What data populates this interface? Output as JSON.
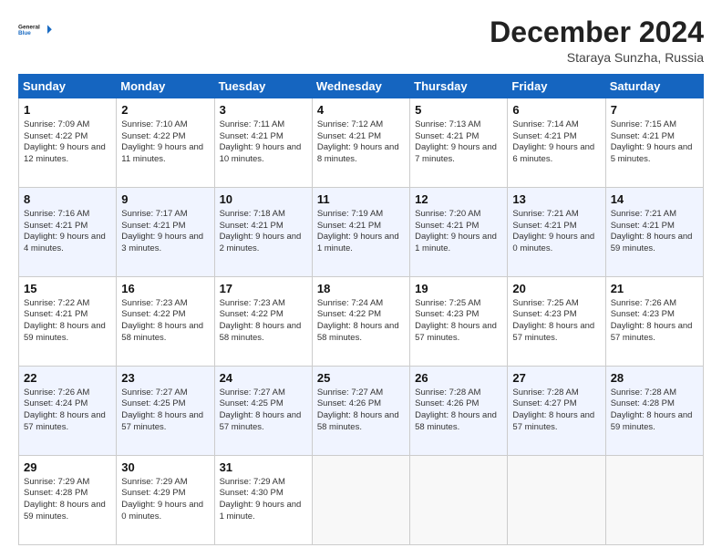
{
  "logo": {
    "line1": "General",
    "line2": "Blue"
  },
  "title": "December 2024",
  "location": "Staraya Sunzha, Russia",
  "days_of_week": [
    "Sunday",
    "Monday",
    "Tuesday",
    "Wednesday",
    "Thursday",
    "Friday",
    "Saturday"
  ],
  "weeks": [
    [
      {
        "day": "1",
        "sr": "7:09 AM",
        "ss": "4:22 PM",
        "dl": "9 hours and 12 minutes."
      },
      {
        "day": "2",
        "sr": "7:10 AM",
        "ss": "4:22 PM",
        "dl": "9 hours and 11 minutes."
      },
      {
        "day": "3",
        "sr": "7:11 AM",
        "ss": "4:21 PM",
        "dl": "9 hours and 10 minutes."
      },
      {
        "day": "4",
        "sr": "7:12 AM",
        "ss": "4:21 PM",
        "dl": "9 hours and 8 minutes."
      },
      {
        "day": "5",
        "sr": "7:13 AM",
        "ss": "4:21 PM",
        "dl": "9 hours and 7 minutes."
      },
      {
        "day": "6",
        "sr": "7:14 AM",
        "ss": "4:21 PM",
        "dl": "9 hours and 6 minutes."
      },
      {
        "day": "7",
        "sr": "7:15 AM",
        "ss": "4:21 PM",
        "dl": "9 hours and 5 minutes."
      }
    ],
    [
      {
        "day": "8",
        "sr": "7:16 AM",
        "ss": "4:21 PM",
        "dl": "9 hours and 4 minutes."
      },
      {
        "day": "9",
        "sr": "7:17 AM",
        "ss": "4:21 PM",
        "dl": "9 hours and 3 minutes."
      },
      {
        "day": "10",
        "sr": "7:18 AM",
        "ss": "4:21 PM",
        "dl": "9 hours and 2 minutes."
      },
      {
        "day": "11",
        "sr": "7:19 AM",
        "ss": "4:21 PM",
        "dl": "9 hours and 1 minute."
      },
      {
        "day": "12",
        "sr": "7:20 AM",
        "ss": "4:21 PM",
        "dl": "9 hours and 1 minute."
      },
      {
        "day": "13",
        "sr": "7:21 AM",
        "ss": "4:21 PM",
        "dl": "9 hours and 0 minutes."
      },
      {
        "day": "14",
        "sr": "7:21 AM",
        "ss": "4:21 PM",
        "dl": "8 hours and 59 minutes."
      }
    ],
    [
      {
        "day": "15",
        "sr": "7:22 AM",
        "ss": "4:21 PM",
        "dl": "8 hours and 59 minutes."
      },
      {
        "day": "16",
        "sr": "7:23 AM",
        "ss": "4:22 PM",
        "dl": "8 hours and 58 minutes."
      },
      {
        "day": "17",
        "sr": "7:23 AM",
        "ss": "4:22 PM",
        "dl": "8 hours and 58 minutes."
      },
      {
        "day": "18",
        "sr": "7:24 AM",
        "ss": "4:22 PM",
        "dl": "8 hours and 58 minutes."
      },
      {
        "day": "19",
        "sr": "7:25 AM",
        "ss": "4:23 PM",
        "dl": "8 hours and 57 minutes."
      },
      {
        "day": "20",
        "sr": "7:25 AM",
        "ss": "4:23 PM",
        "dl": "8 hours and 57 minutes."
      },
      {
        "day": "21",
        "sr": "7:26 AM",
        "ss": "4:23 PM",
        "dl": "8 hours and 57 minutes."
      }
    ],
    [
      {
        "day": "22",
        "sr": "7:26 AM",
        "ss": "4:24 PM",
        "dl": "8 hours and 57 minutes."
      },
      {
        "day": "23",
        "sr": "7:27 AM",
        "ss": "4:25 PM",
        "dl": "8 hours and 57 minutes."
      },
      {
        "day": "24",
        "sr": "7:27 AM",
        "ss": "4:25 PM",
        "dl": "8 hours and 57 minutes."
      },
      {
        "day": "25",
        "sr": "7:27 AM",
        "ss": "4:26 PM",
        "dl": "8 hours and 58 minutes."
      },
      {
        "day": "26",
        "sr": "7:28 AM",
        "ss": "4:26 PM",
        "dl": "8 hours and 58 minutes."
      },
      {
        "day": "27",
        "sr": "7:28 AM",
        "ss": "4:27 PM",
        "dl": "8 hours and 57 minutes."
      },
      {
        "day": "28",
        "sr": "7:28 AM",
        "ss": "4:28 PM",
        "dl": "8 hours and 59 minutes."
      }
    ],
    [
      {
        "day": "29",
        "sr": "7:29 AM",
        "ss": "4:28 PM",
        "dl": "8 hours and 59 minutes."
      },
      {
        "day": "30",
        "sr": "7:29 AM",
        "ss": "4:29 PM",
        "dl": "9 hours and 0 minutes."
      },
      {
        "day": "31",
        "sr": "7:29 AM",
        "ss": "4:30 PM",
        "dl": "9 hours and 1 minute."
      },
      null,
      null,
      null,
      null
    ]
  ],
  "labels": {
    "sunrise": "Sunrise:",
    "sunset": "Sunset:",
    "daylight": "Daylight:"
  }
}
